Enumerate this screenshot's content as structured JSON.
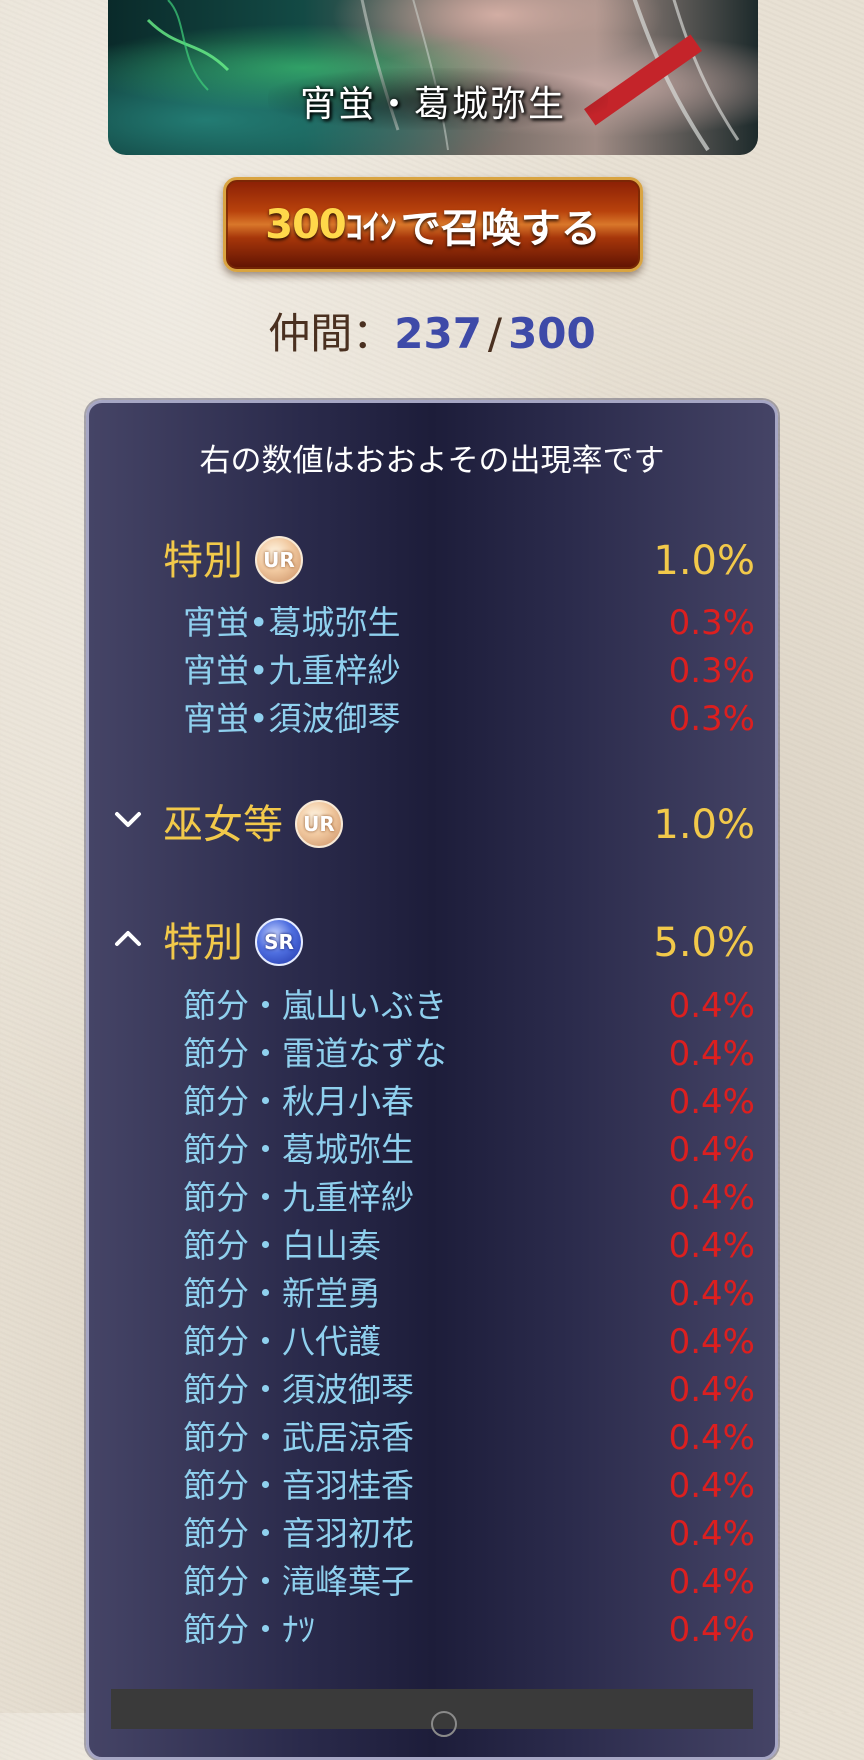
{
  "banner": {
    "title": "宵蛍・葛城弥生"
  },
  "summon_button": {
    "cost": "300",
    "unit": "ｺｲﾝ",
    "action": "で召喚する"
  },
  "companions": {
    "label": "仲間：",
    "current": "237",
    "separator": "/",
    "max": "300"
  },
  "rates": {
    "note": "右の数値はおおよその出現率です",
    "groups": [
      {
        "name": "特別",
        "badge": "UR",
        "rate": "1.0%",
        "expanded": true,
        "chevron": "none",
        "items": [
          {
            "name": "宵蛍•葛城弥生",
            "rate": "0.3%"
          },
          {
            "name": "宵蛍•九重梓紗",
            "rate": "0.3%"
          },
          {
            "name": "宵蛍•須波御琴",
            "rate": "0.3%"
          }
        ]
      },
      {
        "name": "巫女等",
        "badge": "UR",
        "rate": "1.0%",
        "expanded": false,
        "chevron": "chevron-down-icon",
        "items": []
      },
      {
        "name": "特別",
        "badge": "SR",
        "rate": "5.0%",
        "expanded": true,
        "chevron": "chevron-up-icon",
        "items": [
          {
            "name": "節分・嵐山いぶき",
            "rate": "0.4%"
          },
          {
            "name": "節分・雷道なずな",
            "rate": "0.4%"
          },
          {
            "name": "節分・秋月小春",
            "rate": "0.4%"
          },
          {
            "name": "節分・葛城弥生",
            "rate": "0.4%"
          },
          {
            "name": "節分・九重梓紗",
            "rate": "0.4%"
          },
          {
            "name": "節分・白山奏",
            "rate": "0.4%"
          },
          {
            "name": "節分・新堂勇",
            "rate": "0.4%"
          },
          {
            "name": "節分・八代護",
            "rate": "0.4%"
          },
          {
            "name": "節分・須波御琴",
            "rate": "0.4%"
          },
          {
            "name": "節分・武居涼香",
            "rate": "0.4%"
          },
          {
            "name": "節分・音羽桂香",
            "rate": "0.4%"
          },
          {
            "name": "節分・音羽初花",
            "rate": "0.4%"
          },
          {
            "name": "節分・滝峰葉子",
            "rate": "0.4%"
          },
          {
            "name": "節分・ﾅﾂ",
            "rate": "0.4%"
          }
        ]
      }
    ]
  },
  "colors": {
    "accent_gold": "#f2c94a",
    "item_name": "#8fd0ee",
    "item_rate": "#dc1f1f",
    "count_number": "#3e4aa8",
    "panel_bg": "#2b2b4c"
  }
}
